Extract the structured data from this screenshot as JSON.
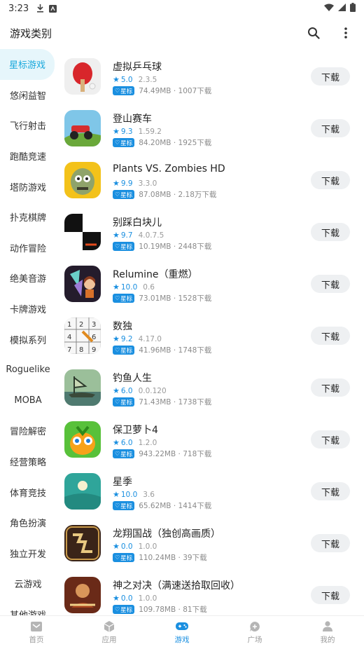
{
  "status_bar": {
    "time": "3:23"
  },
  "header": {
    "title": "游戏类别"
  },
  "sidebar": {
    "items": [
      {
        "label": "星标游戏",
        "active": true
      },
      {
        "label": "悠闲益智"
      },
      {
        "label": "飞行射击"
      },
      {
        "label": "跑酷竞速"
      },
      {
        "label": "塔防游戏"
      },
      {
        "label": "扑克棋牌"
      },
      {
        "label": "动作冒险"
      },
      {
        "label": "绝美音游"
      },
      {
        "label": "卡牌游戏"
      },
      {
        "label": "模拟系列"
      },
      {
        "label": "Roguelike"
      },
      {
        "label": "MOBA"
      },
      {
        "label": "冒险解密"
      },
      {
        "label": "经营策略"
      },
      {
        "label": "体育竞技"
      },
      {
        "label": "角色扮演"
      },
      {
        "label": "独立开发"
      },
      {
        "label": "云游戏"
      },
      {
        "label": "其他游戏"
      }
    ]
  },
  "apps": [
    {
      "name": "虚拟乒乓球",
      "score": "5.0",
      "version": "2.3.5",
      "meta": "74.49MB · 1007下载",
      "icon": "ping-pong-icon"
    },
    {
      "name": "登山赛车",
      "score": "9.3",
      "version": "1.59.2",
      "meta": "84.20MB · 1925下载",
      "icon": "hill-climb-icon"
    },
    {
      "name": "Plants VS. Zombies HD",
      "score": "9.9",
      "version": "3.3.0",
      "meta": "87.08MB · 2.18万下载",
      "icon": "zombie-icon"
    },
    {
      "name": "别踩白块儿",
      "score": "9.7",
      "version": "4.0.7.5",
      "meta": "10.19MB · 2448下载",
      "icon": "piano-tiles-icon"
    },
    {
      "name": "Relumine（重燃）",
      "score": "10.0",
      "version": "0.6",
      "meta": "73.01MB · 1528下载",
      "icon": "relumine-icon"
    },
    {
      "name": "数独",
      "score": "9.2",
      "version": "4.17.0",
      "meta": "41.96MB · 1748下载",
      "icon": "sudoku-icon"
    },
    {
      "name": "钓鱼人生",
      "score": "6.0",
      "version": "0.0.120",
      "meta": "71.43MB · 1738下载",
      "icon": "fishing-icon"
    },
    {
      "name": "保卫萝卜4",
      "score": "6.0",
      "version": "1.2.0",
      "meta": "943.22MB · 718下载",
      "icon": "carrot-icon"
    },
    {
      "name": "星季",
      "score": "10.0",
      "version": "3.6",
      "meta": "65.62MB · 1414下载",
      "icon": "star-season-icon"
    },
    {
      "name": "龙翔国战（独创高画质）",
      "score": "0.0",
      "version": "1.0.0",
      "meta": "110.24MB · 39下载",
      "icon": "dragon-war-icon"
    },
    {
      "name": "神之对决（满速送拾取回收）",
      "score": "0.0",
      "version": "1.0.0",
      "meta": "109.78MB · 81下载",
      "icon": "god-duel-icon"
    }
  ],
  "badge_label": "星标",
  "download_label": "下载",
  "bottom_nav": [
    {
      "label": "首页",
      "icon": "home-icon"
    },
    {
      "label": "应用",
      "icon": "apps-icon"
    },
    {
      "label": "游戏",
      "icon": "gamepad-icon",
      "active": true
    },
    {
      "label": "广场",
      "icon": "chat-icon"
    },
    {
      "label": "我的",
      "icon": "person-icon"
    }
  ],
  "colors": {
    "accent": "#1a8fe0",
    "sidebar_active_bg": "#e6f6fb",
    "sidebar_active_text": "#18a8dc"
  }
}
